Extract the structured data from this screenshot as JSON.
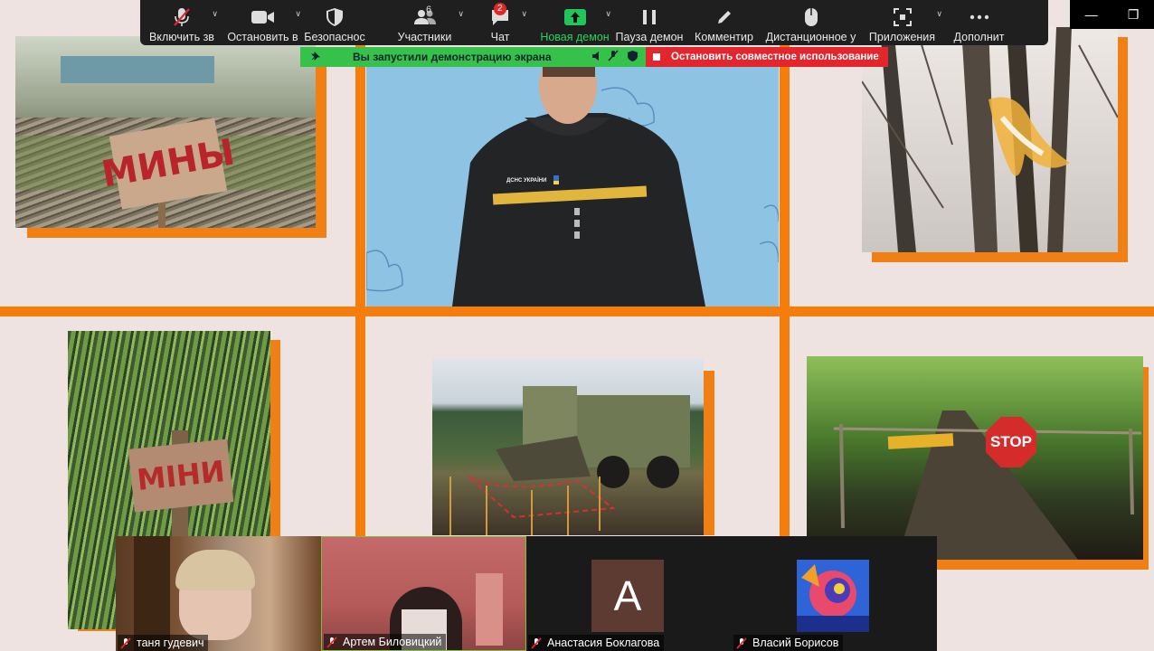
{
  "toolbar": {
    "items": [
      {
        "label": "Включить зв",
        "icon": "microphone-muted-icon"
      },
      {
        "label": "Остановить в",
        "icon": "video-camera-icon"
      },
      {
        "label": "Безопаснос",
        "icon": "shield-icon"
      },
      {
        "label": "Участники",
        "icon": "participants-icon",
        "count": "6"
      },
      {
        "label": "Чат",
        "icon": "chat-icon",
        "badge": "2"
      },
      {
        "label": "Новая демон",
        "icon": "share-screen-icon"
      },
      {
        "label": "Пауза демон",
        "icon": "pause-icon"
      },
      {
        "label": "Комментир",
        "icon": "pencil-icon"
      },
      {
        "label": "Дистанционное у",
        "icon": "mouse-icon"
      },
      {
        "label": "Приложения",
        "icon": "apps-icon"
      },
      {
        "label": "Дополнит",
        "icon": "more-icon"
      }
    ]
  },
  "share_banner": {
    "text": "Вы запустили демонстрацию экрана",
    "stop_label": "Остановить совместное использование"
  },
  "slide": {
    "sign_mines_text": "МИНЫ",
    "sign_miny_text": "МІНИ",
    "stop_sign_text": "STOP",
    "patch_text": "ДСНС УКРАЇНИ"
  },
  "participants": [
    {
      "name": "таня гудевич",
      "type": "video"
    },
    {
      "name": "Артем Биловицкий",
      "type": "video"
    },
    {
      "name": "Анастасия Боклагова",
      "type": "avatar",
      "initial": "А"
    },
    {
      "name": "Власий Борисов",
      "type": "avatar-image"
    }
  ],
  "colors": {
    "accent_orange": "#f57d0c",
    "toolbar_bg": "#1f1f1f",
    "share_green": "#35c14a",
    "stop_red": "#e3262e",
    "slide_bg": "#efe3e2"
  }
}
